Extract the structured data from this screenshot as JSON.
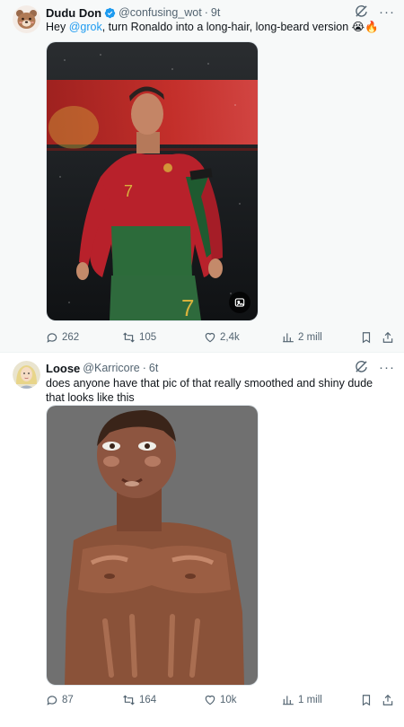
{
  "tweets": [
    {
      "name": "Dudu Don",
      "handle": "@confusing_wot",
      "separator": "·",
      "time": "9t",
      "text_parts": [
        "Hey ",
        "@grok",
        ", turn Ronaldo into a long-hair, long-beard version 😭🔥"
      ],
      "replies": "262",
      "reposts": "105",
      "likes": "2,4k",
      "views": "2 mill",
      "colors": {
        "background": "#f7f9f9"
      }
    },
    {
      "name": "Loose",
      "handle": "@Karricore",
      "separator": "·",
      "time": "6t",
      "text": "does anyone have that pic of that really smoothed and shiny dude that looks like this",
      "replies": "87",
      "reposts": "164",
      "likes": "10k",
      "views": "1 mill",
      "colors": {
        "background": "#ffffff"
      }
    }
  ],
  "icons": [
    "bear-avatar-icon",
    "verified-badge-icon",
    "grok-icon",
    "more-icon",
    "reply-icon",
    "repost-icon",
    "like-icon",
    "views-icon",
    "bookmark-icon",
    "share-icon",
    "alt-text-icon"
  ],
  "colors": {
    "accent": "#1d9bf0",
    "muted": "#536471",
    "divider": "#eff3f4"
  }
}
